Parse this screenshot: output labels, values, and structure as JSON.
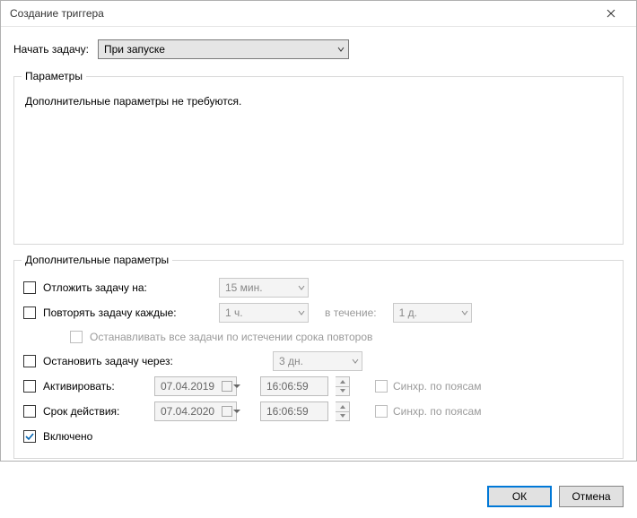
{
  "window": {
    "title": "Создание триггера"
  },
  "top": {
    "begin_task_label": "Начать задачу:",
    "trigger_value": "При запуске"
  },
  "params": {
    "legend": "Параметры",
    "body_text": "Дополнительные параметры не требуются."
  },
  "advanced": {
    "legend": "Дополнительные параметры",
    "delay": {
      "label": "Отложить задачу на:",
      "value": "15 мин."
    },
    "repeat": {
      "label": "Повторять задачу каждые:",
      "value": "1 ч.",
      "duration_label": "в течение:",
      "duration_value": "1 д."
    },
    "stop_all": {
      "label": "Останавливать все задачи по истечении срока повторов"
    },
    "stop_after": {
      "label": "Остановить задачу через:",
      "value": "3 дн."
    },
    "activate": {
      "label": "Активировать:",
      "date": "07.04.2019",
      "time": "16:06:59",
      "sync_label": "Синхр. по поясам"
    },
    "expire": {
      "label": "Срок действия:",
      "date": "07.04.2020",
      "time": "16:06:59",
      "sync_label": "Синхр. по поясам"
    },
    "enabled": {
      "label": "Включено"
    }
  },
  "buttons": {
    "ok": "ОК",
    "cancel": "Отмена"
  }
}
